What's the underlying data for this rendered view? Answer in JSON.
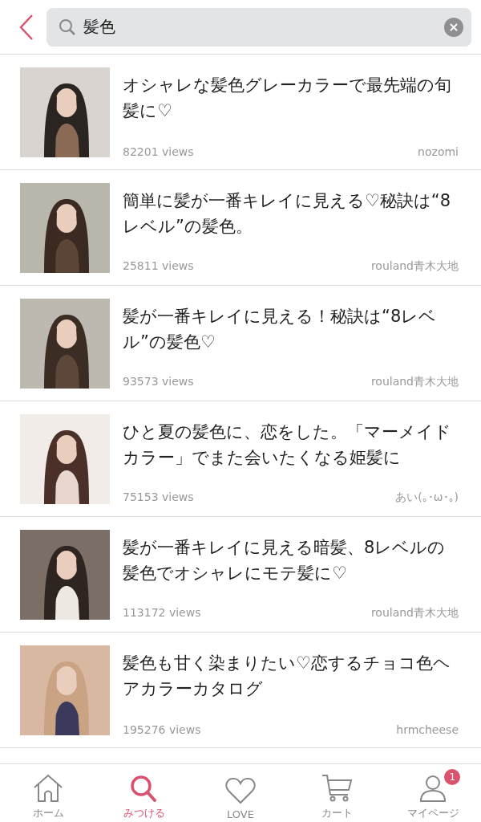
{
  "search": {
    "value": "髪色"
  },
  "articles": [
    {
      "title": "オシャレな髪色グレーカラーで最先端の旬髪に♡",
      "views": "82201 views",
      "author": "nozomi"
    },
    {
      "title": "簡単に髪が一番キレイに見える♡秘訣は“8レベル”の髪色。",
      "views": "25811 views",
      "author": "rouland青木大地"
    },
    {
      "title": "髪が一番キレイに見える！秘訣は“8レベル”の髪色♡",
      "views": "93573 views",
      "author": "rouland青木大地"
    },
    {
      "title": "ひと夏の髪色に、恋をした。「マーメイドカラー」でまた会いたくなる姫髪に",
      "views": "75153 views",
      "author": "あい(｡･ω･｡)"
    },
    {
      "title": "髪が一番キレイに見える暗髪、8レベルの髪色でオシャレにモテ髪に♡",
      "views": "113172 views",
      "author": "rouland青木大地"
    },
    {
      "title": "髪色も甘く染まりたい♡恋するチョコ色ヘアカラーカタログ",
      "views": "195276 views",
      "author": "hrmcheese"
    }
  ],
  "nav": [
    {
      "kind": "home",
      "label": "ホーム",
      "selected": false
    },
    {
      "kind": "search",
      "label": "みつける",
      "selected": true
    },
    {
      "kind": "heart",
      "label": "LOVE",
      "selected": false
    },
    {
      "kind": "cart",
      "label": "カート",
      "selected": false
    },
    {
      "kind": "user",
      "label": "マイページ",
      "selected": false,
      "badge": "1"
    }
  ]
}
